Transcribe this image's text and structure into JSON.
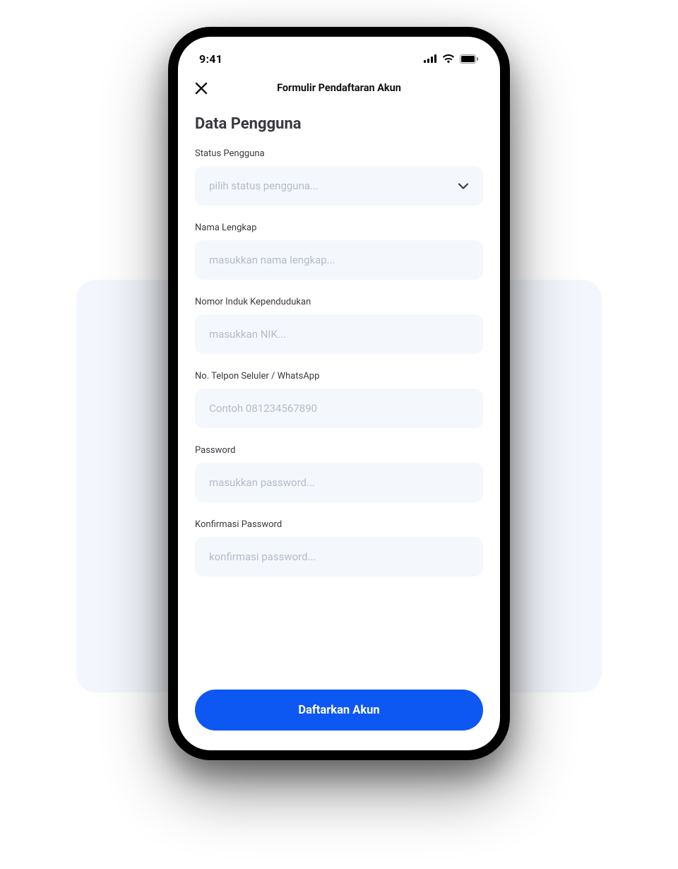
{
  "statusBar": {
    "time": "9:41"
  },
  "appBar": {
    "title": "Formulir Pendaftaran Akun"
  },
  "sectionTitle": "Data Pengguna",
  "fields": {
    "status": {
      "label": "Status Pengguna",
      "placeholder": "pilih status pengguna...",
      "value": ""
    },
    "fullName": {
      "label": "Nama Lengkap",
      "placeholder": "masukkan nama lengkap...",
      "value": ""
    },
    "nik": {
      "label": "Nomor Induk Kependudukan",
      "placeholder": "masukkan NIK...",
      "value": ""
    },
    "phone": {
      "label": "No. Telpon Seluler / WhatsApp",
      "placeholder": "Contoh 081234567890",
      "value": ""
    },
    "password": {
      "label": "Password",
      "placeholder": "masukkan password...",
      "value": ""
    },
    "confirmPassword": {
      "label": "Konfirmasi Password",
      "placeholder": "konfirmasi password...",
      "value": ""
    }
  },
  "submitButton": {
    "label": "Daftarkan Akun"
  },
  "colors": {
    "primary": "#0D57F2",
    "inputBg": "#F4F7FC"
  }
}
